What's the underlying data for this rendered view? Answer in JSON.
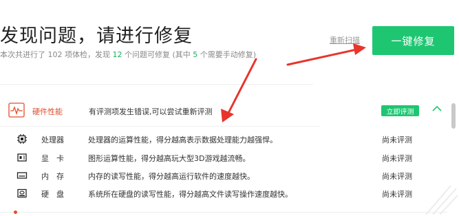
{
  "header": {
    "title": "发现问题，请进行修复",
    "summary_prefix": "本次共进行了 102 项体检，发现 ",
    "problems_count": "12",
    "summary_mid": " 个问题可修复 (其中 ",
    "manual_count": "5",
    "summary_suffix": " 个需要手动修复)",
    "rescan_label": "重新扫描",
    "fix_button_label": "一键修复"
  },
  "hardware": {
    "category_label": "硬件性能",
    "message": "有评测项发生错误,可以尝试重新评测",
    "badge_label": "立即评测",
    "items": [
      {
        "name": "处理器",
        "desc": "处理器的运算性能，得分越高表示数据处理能力越强悍。",
        "status": "尚未评测",
        "icon": "cpu-icon"
      },
      {
        "name": "显　卡",
        "desc": "图形运算性能，得分越高玩大型3D游戏越流畅。",
        "status": "尚未评测",
        "icon": "gpu-icon"
      },
      {
        "name": "内　存",
        "desc": "内存的读写性能，得分越高运行软件的速度越快。",
        "status": "尚未评测",
        "icon": "memory-icon"
      },
      {
        "name": "硬　盘",
        "desc": "系统所在硬盘的读写性能，得分越高文件读写操作速度越快。",
        "status": "尚未评测",
        "icon": "disk-icon"
      }
    ]
  },
  "colors": {
    "accent_green": "#1ec672",
    "warning_red": "#e24c2c",
    "annotation_red": "#e8342a"
  }
}
